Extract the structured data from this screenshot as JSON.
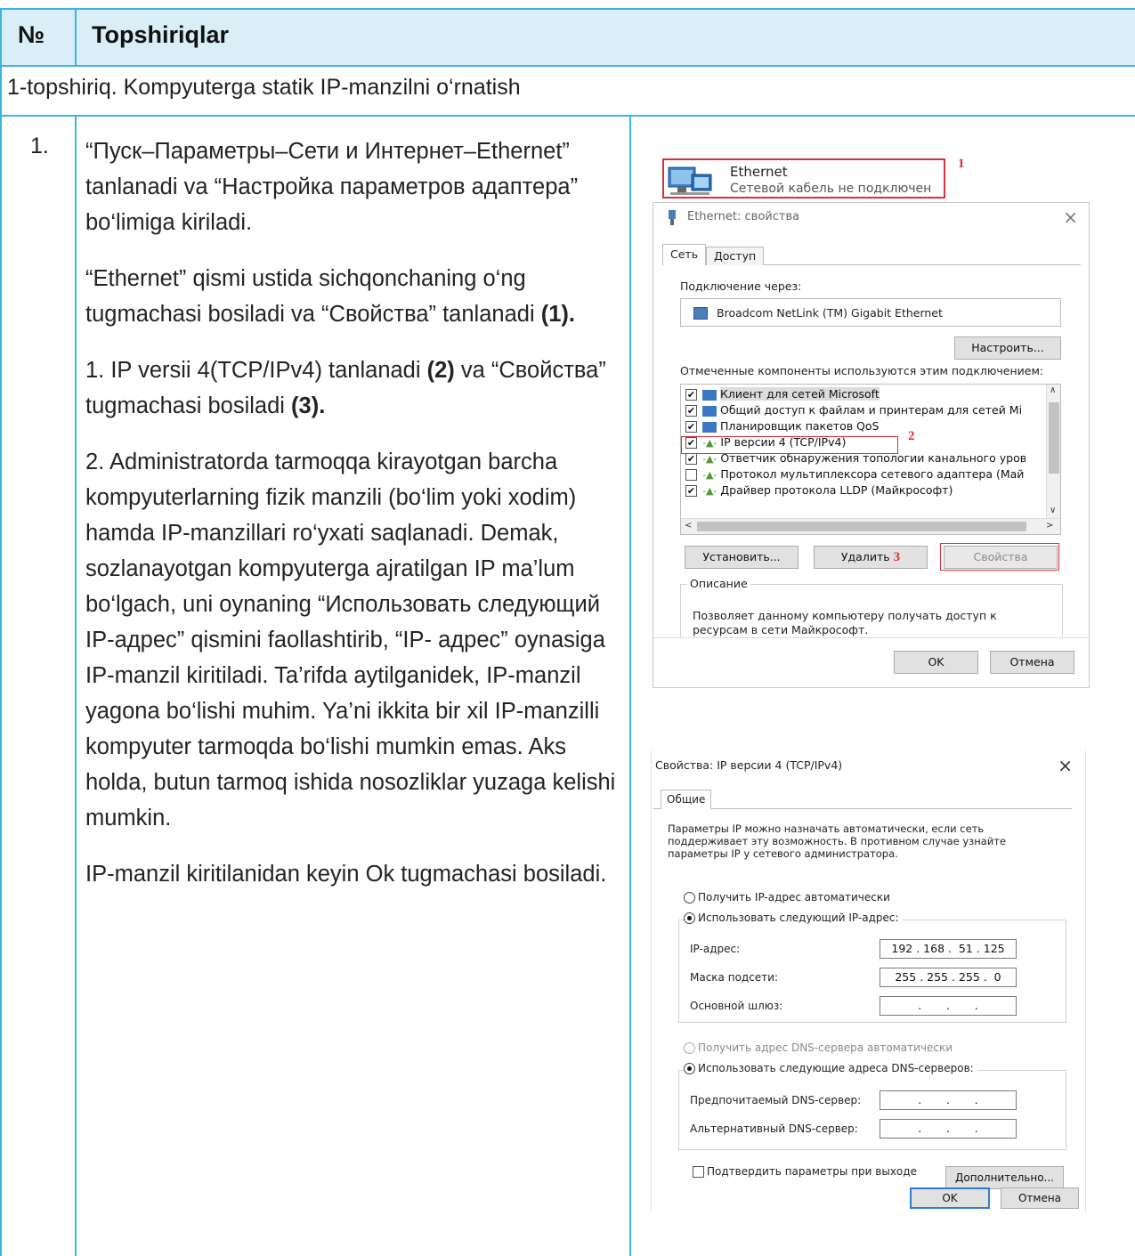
{
  "table": {
    "header_num": "№",
    "header_title": "Topshiriqlar",
    "task_title": "1-topshiriq. Kompyuterga statik IP-manzilni o‘rnatish",
    "step_num": "1.",
    "paragraphs": {
      "p1": "“Пуск–Параметры–Сети и Интернет–Ethernet” tanlanadi va “Настройка параметров адаптера” bo‘limiga kiriladi.",
      "p2_text": "“Ethernet”  qismi ustida sichqonchaning o‘ng tugmachasi bosiladi va “Свойства” tanlanadi ",
      "p2_bold": "(1).",
      "p3_a": "1. IP versii 4(TCP/IPv4)  tanlanadi ",
      "p3_b": "(2)",
      "p3_c": "  va “Свойства” tugmachasi bosiladi ",
      "p3_d": "(3).",
      "p4": "2. Administratorda tarmoqqa kirayotgan barcha kompyuterlarning fizik manzili (bo‘lim yoki xodim) hamda IP-manzillari ro‘yxati saqlanadi. Demak, sozlanayotgan kompyuterga ajratilgan IP ma’lum bo‘lgach, uni oynaning “Использовать следующий IP-адрес” qismini faollashtirib, “IP- адрес” oynasiga IP-manzil kiritiladi. Ta’rifda aytilganidek, IP-manzil yagona bo‘lishi muhim. Ya’ni ikkita bir xil IP-manzilli kompyuter tarmoqda bo‘lishi mumkin emas. Aks holda, butun tarmoq ishida nosozliklar yuzaga kelishi mumkin.",
      "p5": "IP-manzil kiritilanidan keyin Ok tugmachasi bosiladi."
    }
  },
  "shot1": {
    "ethernet_name": "Ethernet",
    "ethernet_status": "Сетевой кабель не подключен",
    "mark1": "1",
    "mark2": "2",
    "mark3": "3",
    "dialog_title": "Ethernet: свойства",
    "close": "×",
    "tab_network": "Сеть",
    "tab_access": "Доступ",
    "connect_via_label": "Подключение через:",
    "adapter_name": "Broadcom NetLink (TM) Gigabit Ethernet",
    "configure_button": "Настроить...",
    "components_label": "Отмеченные компоненты используются этим подключением:",
    "components": [
      {
        "label": "Клиент для сетей Microsoft",
        "checked": true
      },
      {
        "label": "Общий доступ к файлам и принтерам для сетей Mi",
        "checked": true
      },
      {
        "label": "Планировщик пакетов QoS",
        "checked": true
      },
      {
        "label": "IP версии 4 (TCP/IPv4)",
        "checked": true
      },
      {
        "label": "Ответчик обнаружения топологии канального уров",
        "checked": true
      },
      {
        "label": "Протокол мультиплексора сетевого адаптера (Май",
        "checked": false
      },
      {
        "label": "Драйвер протокола LLDP (Майкрософт)",
        "checked": true
      }
    ],
    "install_button": "Установить...",
    "remove_button": "Удалить",
    "properties_button": "Свойства",
    "description_label": "Описание",
    "description_text": "Позволяет данному компьютеру получать доступ к ресурсам в сети Майкрософт.",
    "ok_button": "OK",
    "cancel_button": "Отмена"
  },
  "shot2": {
    "title": "Свойства: IP версии 4 (TCP/IPv4)",
    "close": "×",
    "tab_general": "Общие",
    "intro": "Параметры IP можно назначать автоматически, если сеть поддерживает эту возможность. В противном случае узнайте параметры IP у сетевого администратора.",
    "radio_auto_ip": "Получить IP-адрес автоматически",
    "radio_manual_ip": "Использовать следующий IP-адрес:",
    "ip_label": "IP-адрес:",
    "ip_value": "192 . 168 .  51 . 125",
    "mask_label": "Маска подсети:",
    "mask_value": "255 . 255 . 255 .  0",
    "gateway_label": "Основной шлюз:",
    "gateway_value": ".       .       .",
    "radio_auto_dns": "Получить адрес DNS-сервера автоматически",
    "radio_manual_dns": "Использовать следующие адреса DNS-серверов:",
    "pref_dns_label": "Предпочитаемый DNS-сервер:",
    "pref_dns_value": ".       .       .",
    "alt_dns_label": "Альтернативный DNS-сервер:",
    "alt_dns_value": ".       .       .",
    "validate_label": "Подтвердить параметры при выходе",
    "advanced_button": "Дополнительно...",
    "ok_button": "OK",
    "cancel_button": "Отмена"
  },
  "colors": {
    "frame": "#3cb4e6",
    "header_bg": "#d9eef7",
    "highlight_red": "#d9303a"
  }
}
